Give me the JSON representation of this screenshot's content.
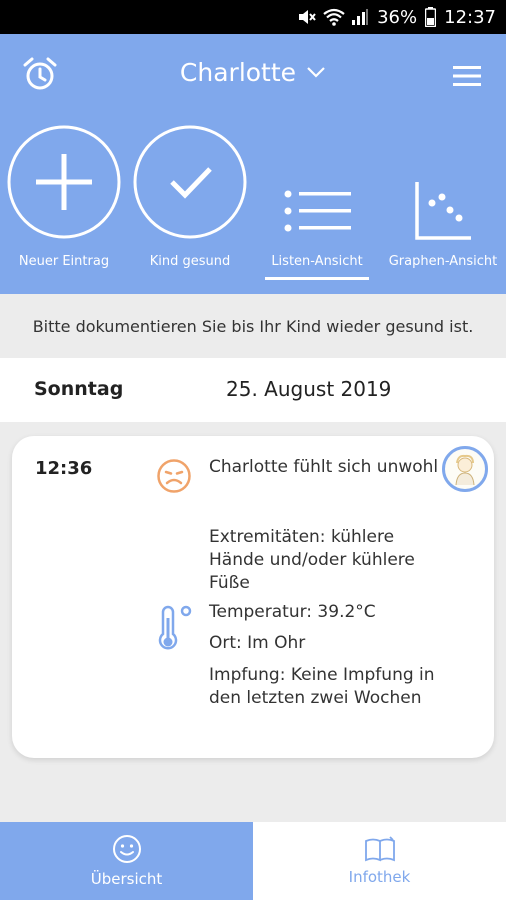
{
  "statusbar": {
    "battery": "36%",
    "time": "12:37"
  },
  "header": {
    "child_name": "Charlotte",
    "actions": [
      {
        "label": "Neuer Eintrag",
        "icon": "plus-circle-icon"
      },
      {
        "label": "Kind gesund",
        "icon": "check-circle-icon"
      },
      {
        "label": "Listen-Ansicht",
        "icon": "list-icon"
      },
      {
        "label": "Graphen-Ansicht",
        "icon": "scatter-graph-icon"
      }
    ],
    "active_action": "Listen-Ansicht"
  },
  "info_text": "Bitte dokumentieren Sie bis Ihr Kind wieder gesund ist.",
  "date_bar": {
    "day": "Sonntag",
    "date": "25. August 2019"
  },
  "entry": {
    "time": "12:36",
    "status": "Charlotte fühlt sich unwohl",
    "extremities": "Extremitäten: kühlere Hände und/oder kühlere Füße",
    "temperature": "Temperatur: 39.2°C",
    "location": "Ort: Im Ohr",
    "vaccination": "Impfung: Keine Impfung in den letzten zwei Wochen"
  },
  "bottom_nav": [
    {
      "label": "Übersicht",
      "icon": "smiley-icon",
      "active": true
    },
    {
      "label": "Infothek",
      "icon": "book-icon",
      "active": false
    }
  ],
  "colors": {
    "accent": "#80a8ec",
    "mood": "#f0a36a"
  }
}
